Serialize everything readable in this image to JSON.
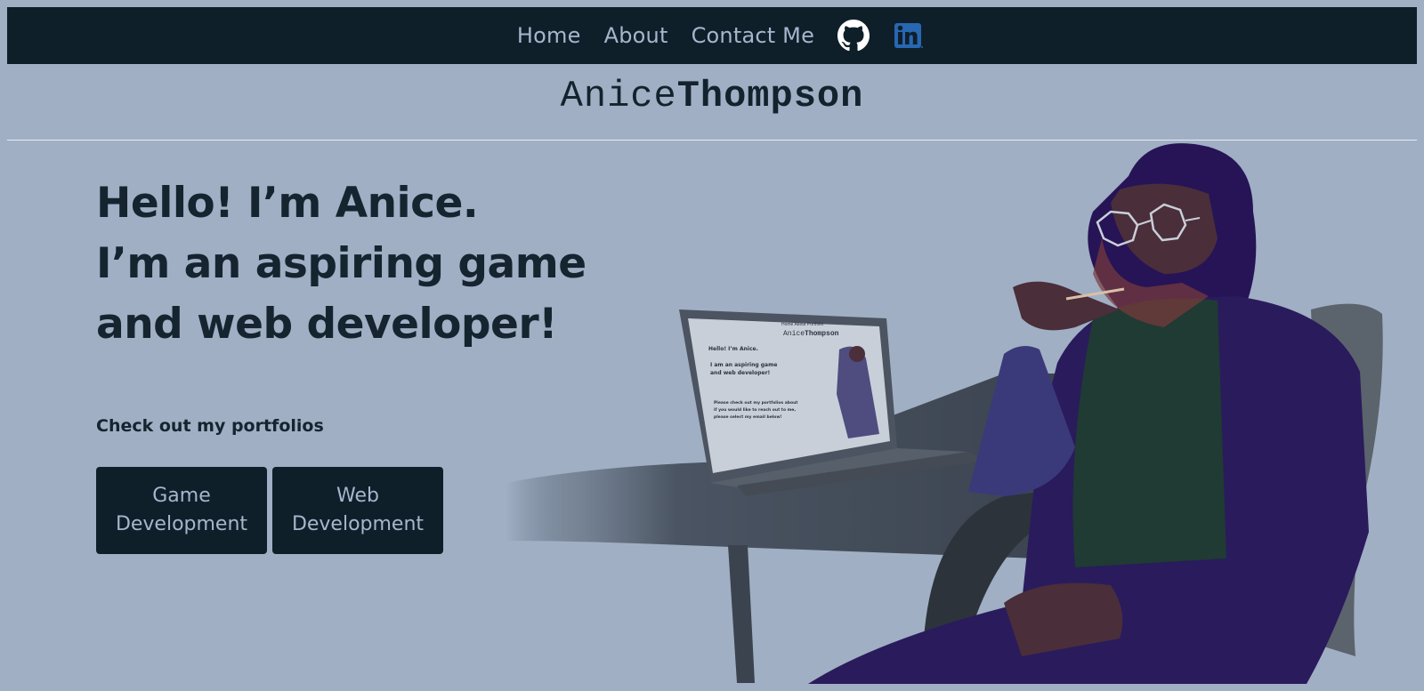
{
  "nav": {
    "links": [
      "Home",
      "About",
      "Contact Me"
    ],
    "icons": [
      "github-icon",
      "linkedin-icon"
    ]
  },
  "brand": {
    "first": "Anice",
    "last": "Thompson"
  },
  "hero": {
    "lines": [
      "Hello! I’m Anice.",
      "I’m an aspiring game",
      "and web developer!"
    ],
    "portfolio_prompt": "Check out my portfolios",
    "buttons": [
      {
        "line1": "Game",
        "line2": "Development"
      },
      {
        "line1": "Web",
        "line2": "Development"
      }
    ]
  },
  "laptop_screen": {
    "nav": "Home  About  Portfolio",
    "brand_first": "Anice",
    "brand_last": "Thompson",
    "line1": "Hello! I’m Anice.",
    "line2": "I am an aspiring game",
    "line3": "and web developer!",
    "para1": "Please check out my portfolios about",
    "para2": "if you would like to reach out to me,",
    "para3": "please select my email below!"
  },
  "colors": {
    "background": "#a0afc4",
    "navbar": "#0f1f2a",
    "nav_text": "#a6b6cc",
    "heading_text": "#15242f",
    "button_bg": "#0f1f2a"
  }
}
